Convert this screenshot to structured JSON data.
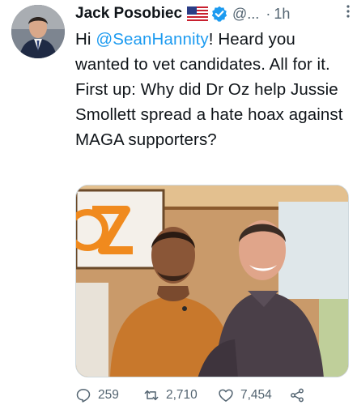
{
  "tweet": {
    "author_name": "Jack Posobiec",
    "handle": "@...",
    "separator": "·",
    "time": "1h",
    "text_prefix": "Hi ",
    "mention": "@SeanHannity",
    "text_suffix": "! Heard you wanted to vet candidates. All for it. First up: Why did Dr Oz help Jussie Smollett spread a hate hoax against MAGA supporters?"
  },
  "icons": {
    "flag": "us-flag-icon",
    "verified": "verified-badge-icon",
    "more": "more-options-icon",
    "reply": "reply-icon",
    "retweet": "retweet-icon",
    "like": "like-icon",
    "share": "share-icon"
  },
  "actions": {
    "reply_count": "259",
    "retweet_count": "2,710",
    "like_count": "7,454"
  },
  "colors": {
    "link": "#1d9bf0",
    "verified": "#1d9bf0",
    "muted": "#536471",
    "text": "#0f1419"
  }
}
